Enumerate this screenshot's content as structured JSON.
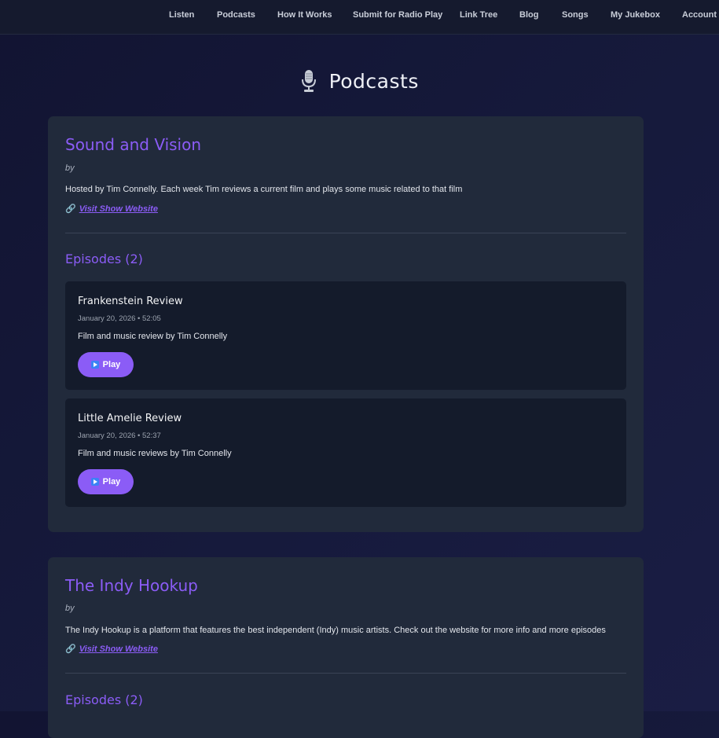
{
  "nav": {
    "items": [
      "Listen",
      "Podcasts",
      "How It Works",
      "Submit for Radio Play",
      "Link Tree",
      "Blog",
      "Songs",
      "My Jukebox",
      "Account"
    ]
  },
  "page": {
    "title": "Podcasts",
    "icon": "microphone-icon"
  },
  "shows": [
    {
      "title": "Sound and Vision",
      "by": "by",
      "description": "Hosted by Tim Connelly. Each week Tim reviews a current film and plays some music related to that film",
      "website_link": "Visit Show Website",
      "episodes_heading": "Episodes (2)",
      "episodes": [
        {
          "title": "Frankenstein Review",
          "meta": "January 20, 2026 • 52:05",
          "description": "Film and music review by Tim Connelly",
          "play_label": "Play"
        },
        {
          "title": "Little Amelie Review",
          "meta": "January 20, 2026 • 52:37",
          "description": "Film and music reviews by Tim Connelly",
          "play_label": "Play"
        }
      ]
    },
    {
      "title": "The Indy Hookup",
      "by": "by",
      "description": "The Indy Hookup is a platform that features the best independent (Indy) music artists. Check out the website for more info and more episodes",
      "website_link": "Visit Show Website",
      "episodes_heading": "Episodes (2)"
    }
  ],
  "colors": {
    "accent": "#8b5cf6",
    "card": "#212a3b",
    "episode_card": "#141b2b",
    "nav_bg": "#151a2e"
  }
}
